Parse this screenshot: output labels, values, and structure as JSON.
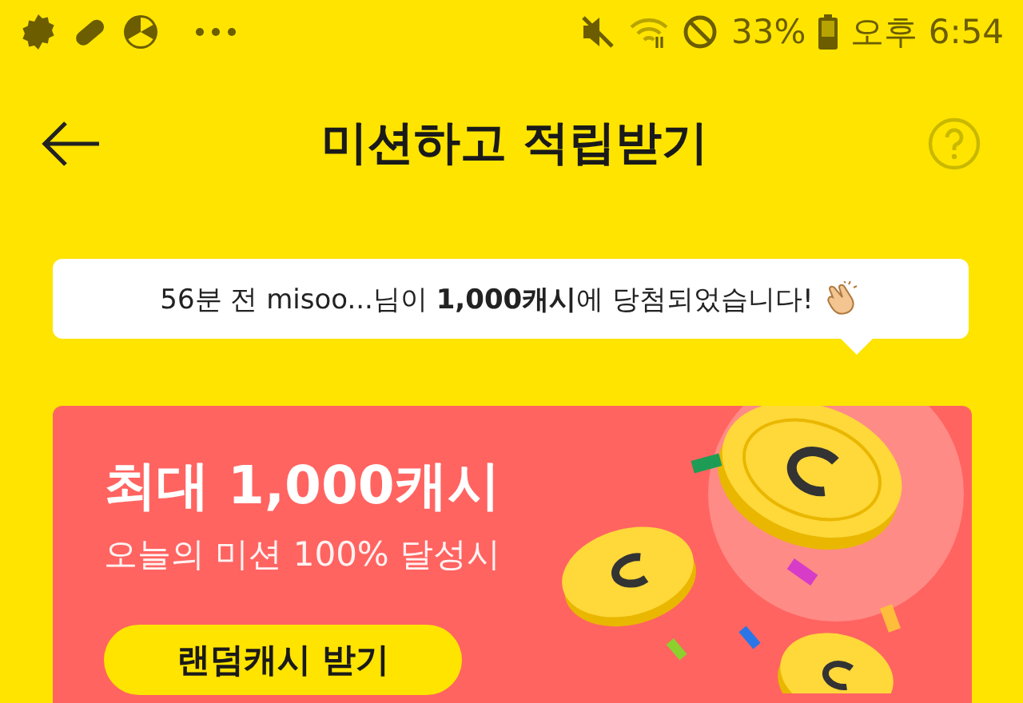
{
  "status_bar": {
    "battery": "33%",
    "time": "오후 6:54"
  },
  "header": {
    "title": "미션하고 적립받기"
  },
  "toast": {
    "text": "56분 전 misoo...님이 **1,000캐시**에 당첨되었습니다!"
  },
  "promo": {
    "title": "최대 1,000캐시",
    "subtitle": "오늘의 미션 100% 달성시",
    "button": "랜덤캐시 받기"
  }
}
